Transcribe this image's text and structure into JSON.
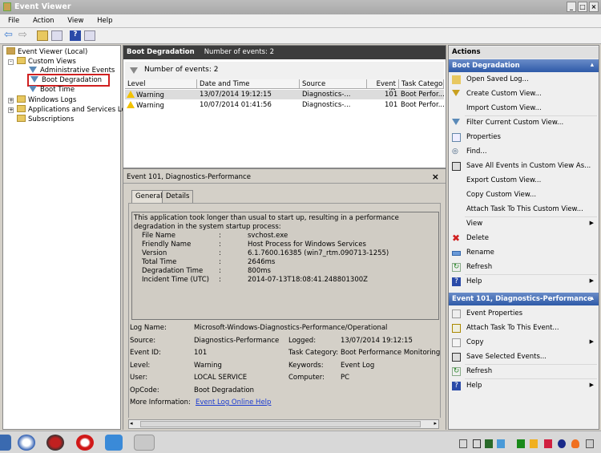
{
  "window": {
    "title": "Event Viewer"
  },
  "menu": [
    "File",
    "Action",
    "View",
    "Help"
  ],
  "toolbar": [
    "back-icon",
    "forward-icon",
    "up-folder-icon",
    "show-hide-tree-icon",
    "help-icon",
    "show-hide-actions-icon"
  ],
  "tree": {
    "root": "Event Viewer (Local)",
    "custom_views": "Custom Views",
    "admin_events": "Administrative Events",
    "boot_degradation": "Boot Degradation",
    "boot_time": "Boot Time",
    "windows_logs": "Windows Logs",
    "app_logs": "Applications and Services Logs",
    "subscriptions": "Subscriptions"
  },
  "middle": {
    "title": "Boot Degradation",
    "count_label": "Number of events: 2",
    "filter_count": "Number of events: 2",
    "columns": [
      "Level",
      "Date and Time",
      "Source",
      "Event ID",
      "Task Category"
    ],
    "rows": [
      {
        "level": "Warning",
        "date": "13/07/2014 19:12:15",
        "source": "Diagnostics-...",
        "id": "101",
        "category": "Boot Perfor..."
      },
      {
        "level": "Warning",
        "date": "10/07/2014 01:41:56",
        "source": "Diagnostics-...",
        "id": "101",
        "category": "Boot Perfor..."
      }
    ]
  },
  "detail": {
    "title": "Event 101, Diagnostics-Performance",
    "close": "×",
    "tabs": [
      "General",
      "Details"
    ],
    "description": "This application took longer than usual to start up, resulting in a performance degradation in the system startup process:",
    "fields": [
      {
        "k": "File Name",
        "v": "svchost.exe"
      },
      {
        "k": "Friendly Name",
        "v": "Host Process for Windows Services"
      },
      {
        "k": "Version",
        "v": "6.1.7600.16385 (win7_rtm.090713-1255)"
      },
      {
        "k": "Total Time",
        "v": "2646ms"
      },
      {
        "k": "Degradation Time",
        "v": "800ms"
      },
      {
        "k": "Incident Time (UTC)",
        "v": "2014-07-13T18:08:41.248801300Z"
      }
    ],
    "sep": ":",
    "meta": {
      "log_name_k": "Log Name:",
      "log_name_v": "Microsoft-Windows-Diagnostics-Performance/Operational",
      "source_k": "Source:",
      "source_v": "Diagnostics-Performance",
      "logged_k": "Logged:",
      "logged_v": "13/07/2014 19:12:15",
      "event_id_k": "Event ID:",
      "event_id_v": "101",
      "task_k": "Task Category:",
      "task_v": "Boot Performance Monitoring",
      "level_k": "Level:",
      "level_v": "Warning",
      "keywords_k": "Keywords:",
      "keywords_v": "Event Log",
      "user_k": "User:",
      "user_v": "LOCAL SERVICE",
      "computer_k": "Computer:",
      "computer_v": "PC",
      "opcode_k": "OpCode:",
      "opcode_v": "Boot Degradation",
      "more_k": "More Information:",
      "more_v": "Event Log Online Help"
    }
  },
  "actions": {
    "header": "Actions",
    "section1": "Boot Degradation",
    "items1": [
      "Open Saved Log...",
      "Create Custom View...",
      "Import Custom View...",
      "Filter Current Custom View...",
      "Properties",
      "Find...",
      "Save All Events in Custom View As...",
      "Export Custom View...",
      "Copy Custom View...",
      "Attach Task To This Custom View...",
      "View",
      "Delete",
      "Rename",
      "Refresh",
      "Help"
    ],
    "section2": "Event 101, Diagnostics-Performance",
    "items2": [
      "Event Properties",
      "Attach Task To This Event...",
      "Copy",
      "Save Selected Events...",
      "Refresh",
      "Help"
    ]
  },
  "colors": {
    "accent": "#2e5aa8",
    "highlight_box": "#d02020",
    "warning": "#f2c200"
  }
}
